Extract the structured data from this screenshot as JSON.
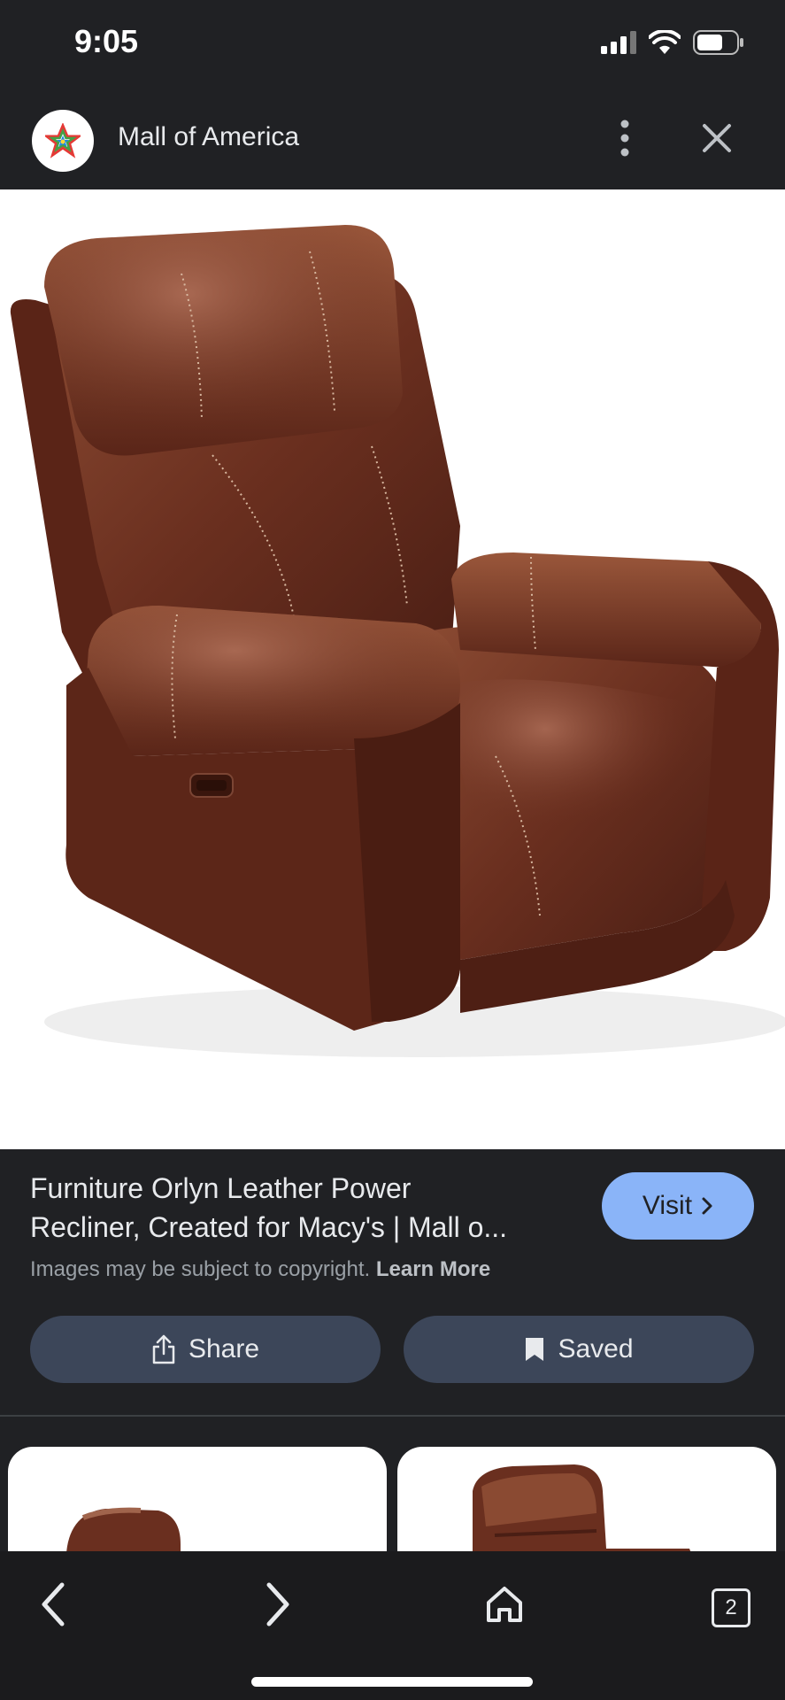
{
  "status_bar": {
    "time": "9:05"
  },
  "header": {
    "site_name": "Mall of America",
    "logo_icon": "multicolor-star-icon"
  },
  "image": {
    "alt": "Brown leather power recliner chair"
  },
  "info": {
    "title_line1": "Furniture Orlyn Leather Power",
    "title_line2": "Recliner, Created for Macy's | Mall o...",
    "visit_label": "Visit",
    "copyright_text": "Images may be subject to copyright.",
    "learn_more": "Learn More",
    "share_label": "Share",
    "saved_label": "Saved"
  },
  "bottom_nav": {
    "tab_count": "2"
  },
  "colors": {
    "accent": "#8ab4f8",
    "button_bg": "#3c4659",
    "background": "#202124"
  }
}
